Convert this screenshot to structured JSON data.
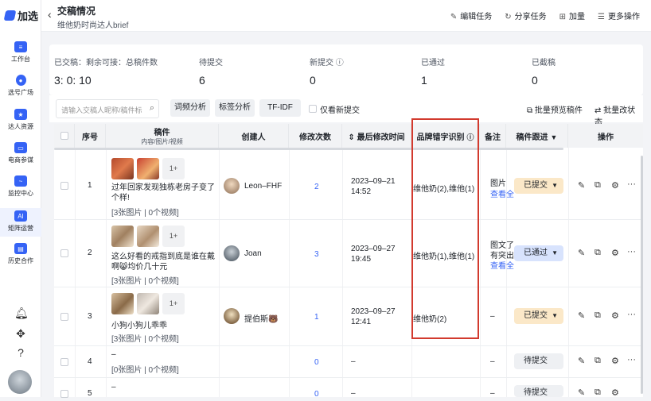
{
  "brand": {
    "name": "加选"
  },
  "sidebar": {
    "items": [
      {
        "label": "工作台",
        "icon": "layers-icon"
      },
      {
        "label": "选号广场",
        "icon": "person-icon"
      },
      {
        "label": "达人资源",
        "icon": "star-folder-icon"
      },
      {
        "label": "电商参谋",
        "icon": "bag-icon"
      },
      {
        "label": "监控中心",
        "icon": "monitor-icon"
      },
      {
        "label": "矩阵运营",
        "icon": "ai-icon"
      },
      {
        "label": "历史合作",
        "icon": "history-icon"
      }
    ]
  },
  "header": {
    "title": "交稿情况",
    "subtitle": "维他奶时尚达人brief",
    "actions": [
      {
        "label": "编辑任务",
        "glyph": "✎"
      },
      {
        "label": "分享任务",
        "glyph": "↻"
      },
      {
        "label": "加量",
        "glyph": "⊞"
      },
      {
        "label": "更多操作",
        "glyph": "☰"
      }
    ]
  },
  "stats": [
    {
      "label": "已交稿：剩余可接：总稿件数",
      "value": "3: 0: 10"
    },
    {
      "label": "待提交",
      "value": "6"
    },
    {
      "label": "新提交 ⓘ",
      "value": "0"
    },
    {
      "label": "已通过",
      "value": "1"
    },
    {
      "label": "已截稿",
      "value": "0"
    }
  ],
  "toolbar": {
    "search_placeholder": "请输入交稿人昵称/稿件标",
    "btn_content": "词频分析",
    "btn_tag": "标签分析",
    "btn_tfidf": "TF-IDF",
    "only_new": "仅看新提交",
    "batch_preview": "批量预览稿件",
    "batch_status": "批量改状态"
  },
  "columns": {
    "index": "序号",
    "manuscript": "稿件",
    "manuscript_sub": "内容/图片/视频",
    "creator": "创建人",
    "edits": "修改次数",
    "last_modified": "最后修改时间",
    "brand_typo": "品牌错字识别",
    "note": "备注",
    "follow": "稿件跟进",
    "ops": "操作"
  },
  "rows": [
    {
      "index": "1",
      "thumbs_more": "1+",
      "title": "过年回家发现独栋老房子变了个样!",
      "media": "[3张图片 | 0个视频]",
      "creator": "Leon–FHF",
      "edits": "2",
      "time": "2023–09–21 14:52",
      "brand": "维他奶(2),维他(1)",
      "note": "图片 ",
      "note2": "查看全",
      "status": "已提交"
    },
    {
      "index": "2",
      "thumbs_more": "1+",
      "title": "这么好看的戒指到底是谁在戴啊😸均价几十元",
      "media": "[3张图片 | 0个视频]",
      "creator": "Joan",
      "edits": "3",
      "time": "2023–09–27 19:45",
      "brand": "维他奶(1),维他(1)",
      "note": "图文了",
      "note2": "有突出",
      "note3": "查看全",
      "status": "已通过"
    },
    {
      "index": "3",
      "thumbs_more": "1+",
      "title": "小狗小狗儿乖乖",
      "media": "[3张图片 | 0个视频]",
      "creator": "提伯斯🐻",
      "edits": "1",
      "time": "2023–09–27 12:41",
      "brand": "维他奶(2)",
      "note": "–",
      "status": "已提交"
    },
    {
      "index": "4",
      "title": "–",
      "media": "[0张图片 | 0个视频]",
      "edits": "0",
      "time": "–",
      "note": "–",
      "status": "待提交"
    },
    {
      "index": "5",
      "title": "–",
      "edits": "0",
      "time": "–",
      "note": "–",
      "status": "待提交"
    }
  ],
  "colors": {
    "accent": "#3563f5",
    "highlight_box": "#d23a2e"
  }
}
